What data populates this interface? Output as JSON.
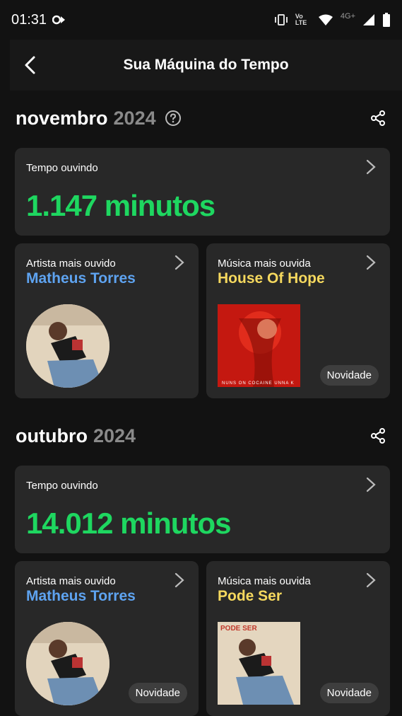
{
  "status": {
    "time": "01:31",
    "network": "4G+",
    "volte": "Vo LTE"
  },
  "appbar": {
    "title": "Sua Máquina do Tempo"
  },
  "sections": [
    {
      "month": "novembro",
      "year": "2024",
      "time_label": "Tempo ouvindo",
      "minutes": "1.147 minutos",
      "artist_label": "Artista mais ouvido",
      "artist_name": "Matheus Torres",
      "song_label": "Música mais ouvida",
      "song_name": "House Of Hope",
      "song_badge": "Novidade",
      "cover_text": "NUNS ON COCAINE  UNNA K"
    },
    {
      "month": "outubro",
      "year": "2024",
      "time_label": "Tempo ouvindo",
      "minutes": "14.012 minutos",
      "artist_label": "Artista mais ouvido",
      "artist_name": "Matheus Torres",
      "artist_badge": "Novidade",
      "song_label": "Música mais ouvida",
      "song_name": "Pode Ser",
      "song_badge": "Novidade",
      "cover_text": "PODE SER"
    }
  ],
  "colors": {
    "accent_green": "#1ed760",
    "artist_blue": "#5ea3f0",
    "song_yellow": "#f5d85e"
  }
}
